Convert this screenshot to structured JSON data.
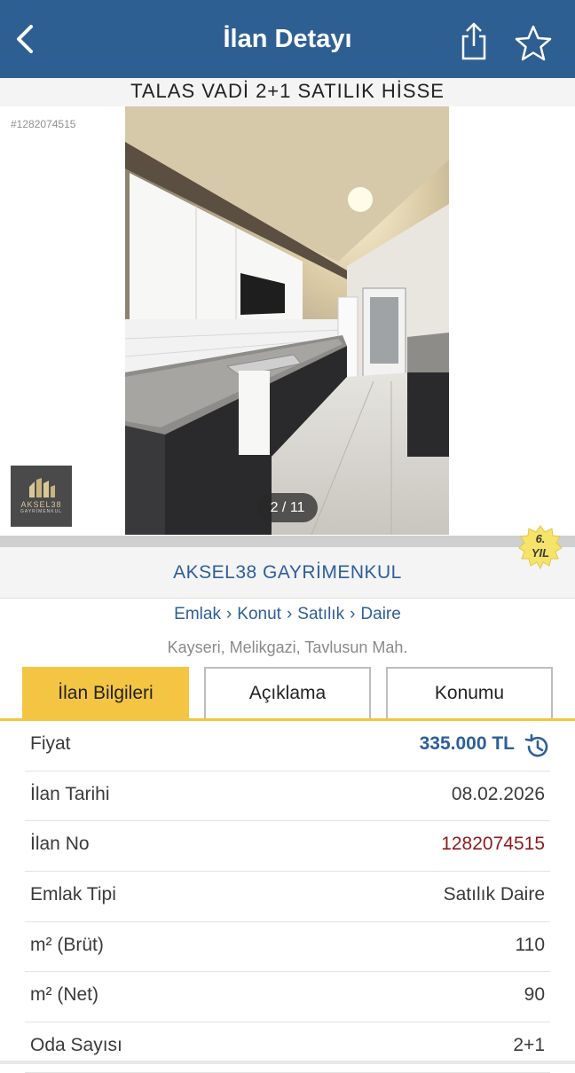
{
  "header": {
    "title": "İlan Detayı",
    "back_icon": "chevron-left-icon",
    "share_icon": "share-icon",
    "favorite_icon": "star-icon"
  },
  "listing": {
    "title": "TALAS VADİ 2+1 SATILIK HİSSE",
    "id_label": "#1282074515"
  },
  "gallery": {
    "counter": "2 / 11"
  },
  "agency": {
    "name": "AKSEL38 GAYRİMENKUL",
    "logo_text": "AKSEL38",
    "logo_subtext": "GAYRİMENKUL",
    "year_badge_number": "6.",
    "year_badge_text": "YIL"
  },
  "breadcrumb": [
    "Emlak",
    "Konut",
    "Satılık",
    "Daire"
  ],
  "location": "Kayseri, Melikgazi, Tavlusun Mah.",
  "tabs": [
    {
      "label": "İlan Bilgileri",
      "active": true
    },
    {
      "label": "Açıklama",
      "active": false
    },
    {
      "label": "Konumu",
      "active": false
    }
  ],
  "info": [
    {
      "label": "Fiyat",
      "value": "335.000 TL"
    },
    {
      "label": "İlan Tarihi",
      "value": "08.02.2026"
    },
    {
      "label": "İlan No",
      "value": "1282074515"
    },
    {
      "label": "Emlak Tipi",
      "value": "Satılık Daire"
    },
    {
      "label": "m² (Brüt)",
      "value": "110"
    },
    {
      "label": "m² (Net)",
      "value": "90"
    },
    {
      "label": "Oda Sayısı",
      "value": "2+1"
    }
  ],
  "colors": {
    "header_bg": "#2e5f93",
    "accent_blue": "#2d5f9a",
    "tab_active": "#f4c542",
    "listing_no_red": "#8b1c1c"
  }
}
